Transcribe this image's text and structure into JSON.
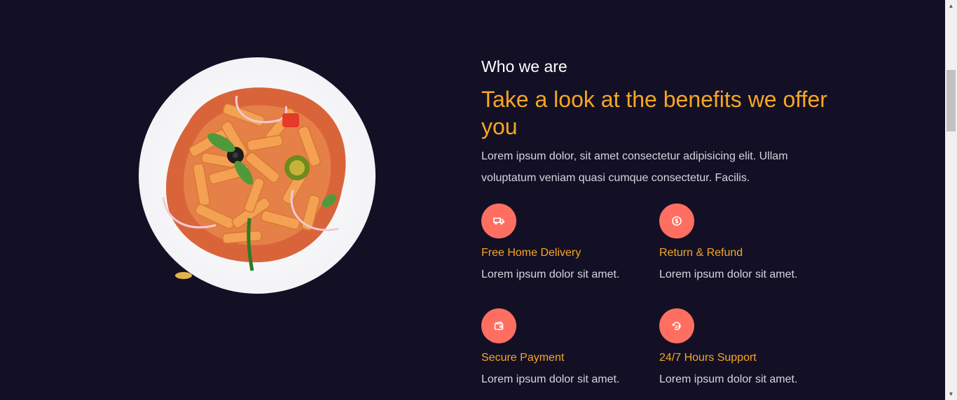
{
  "about": {
    "eyebrow": "Who we are",
    "heading": "Take a look at the benefits we offer you",
    "intro": "Lorem ipsum dolor, sit amet consectetur adipisicing elit. Ullam voluptatum veniam quasi cumque consectetur. Facilis."
  },
  "features": [
    {
      "icon": "truck-icon",
      "title": "Free Home Delivery",
      "desc": "Lorem ipsum dolor sit amet."
    },
    {
      "icon": "coin-icon",
      "title": "Return & Refund",
      "desc": "Lorem ipsum dolor sit amet."
    },
    {
      "icon": "card-icon",
      "title": "Secure Payment",
      "desc": "Lorem ipsum dolor sit amet."
    },
    {
      "icon": "support-24-icon",
      "title": "24/7 Hours Support",
      "desc": "Lorem ipsum dolor sit amet."
    }
  ],
  "colors": {
    "background": "#131025",
    "accent": "#f5a623",
    "icon_circle": "#ff6f61",
    "text": "#d6d3e0"
  }
}
